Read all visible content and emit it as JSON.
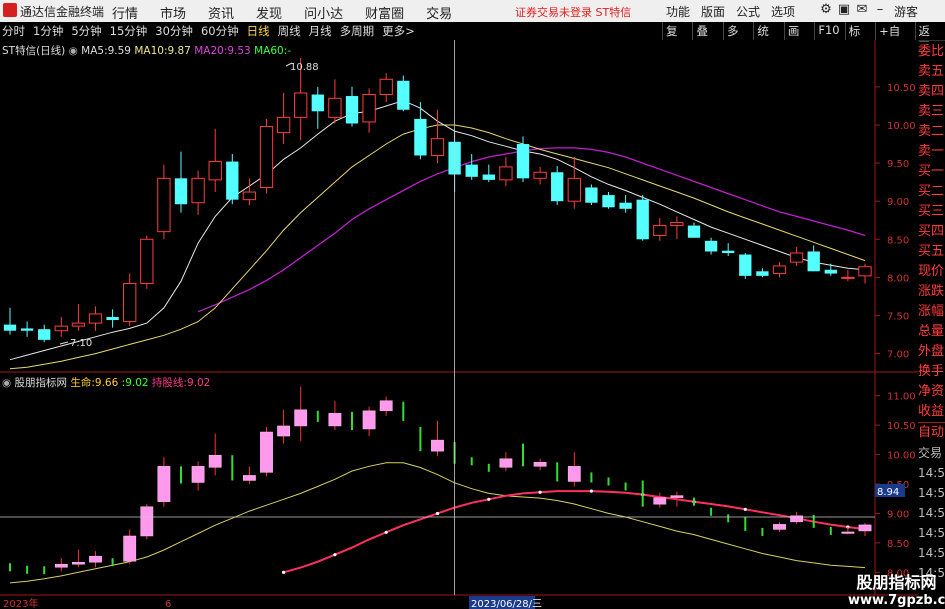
{
  "titlebar": {
    "app_name": "通达信金融终端",
    "menu": [
      "行情",
      "市场",
      "资讯",
      "发现",
      "问小达",
      "财富圈",
      "交易"
    ],
    "notice": "证券交易未登录  ST特信",
    "tools": [
      "功能",
      "版面",
      "公式",
      "选项"
    ],
    "guest": "游客"
  },
  "tabbar": {
    "tabs": [
      "分时",
      "1分钟",
      "5分钟",
      "15分钟",
      "30分钟",
      "60分钟",
      "日线",
      "周线",
      "月线",
      "多周期",
      "更多>"
    ],
    "active": "日线",
    "right_tools": [
      "复权",
      "叠加",
      "多股",
      "统计",
      "画线",
      "F10",
      "标记",
      "+自选",
      "返回"
    ]
  },
  "main_info": {
    "name": "ST特信(日线)",
    "ma5_label": "MA5:",
    "ma5": "9.59",
    "ma10_label": "MA10:",
    "ma10": "9.87",
    "ma20_label": "MA20:",
    "ma20": "9.53",
    "ma60_label": "MA60:",
    "ma60": "-"
  },
  "sub_info": {
    "name": "股朋指标网",
    "life_label": "生命:",
    "life1": "9.66",
    "life2": "9.02",
    "hold_label": "持股线:",
    "hold": "9.02"
  },
  "right_panel": {
    "labels": [
      "委比",
      "卖五",
      "卖四",
      "卖三",
      "卖二",
      "卖一",
      "买一",
      "买二",
      "买三",
      "买四",
      "买五",
      "现价",
      "涨跌",
      "涨幅",
      "总量",
      "外盘",
      "换手",
      "净资",
      "收益"
    ],
    "auto": "自动",
    "trade": "交易",
    "times": [
      "14:56",
      "14:56",
      "14:56",
      "14:56",
      "14:56",
      "14:56",
      "14:56",
      "14:56"
    ]
  },
  "bottom_axis": {
    "year": "2023年",
    "month": "6",
    "cursor_date": "2023/06/28/三"
  },
  "cursor_price": "8.94",
  "watermark": {
    "name": "股朋指标网",
    "url": "www.7gpzb.com"
  },
  "chart_data": {
    "type": "candlestick",
    "main": {
      "y_ticks": [
        "10.50",
        "10.00",
        "9.50",
        "9.00",
        "8.50",
        "8.00",
        "7.50",
        "7.00"
      ],
      "ylim": [
        6.85,
        11.05
      ],
      "high_label": "10.88",
      "low_label": "7.10",
      "candles": [
        {
          "o": 7.38,
          "h": 7.6,
          "l": 7.25,
          "c": 7.3
        },
        {
          "o": 7.33,
          "h": 7.42,
          "l": 7.22,
          "c": 7.3
        },
        {
          "o": 7.32,
          "h": 7.38,
          "l": 7.15,
          "c": 7.18
        },
        {
          "o": 7.3,
          "h": 7.48,
          "l": 7.22,
          "c": 7.36
        },
        {
          "o": 7.36,
          "h": 7.65,
          "l": 7.3,
          "c": 7.4
        },
        {
          "o": 7.4,
          "h": 7.62,
          "l": 7.3,
          "c": 7.52
        },
        {
          "o": 7.48,
          "h": 7.58,
          "l": 7.34,
          "c": 7.44
        },
        {
          "o": 7.42,
          "h": 8.05,
          "l": 7.36,
          "c": 7.92
        },
        {
          "o": 7.92,
          "h": 8.55,
          "l": 7.85,
          "c": 8.5
        },
        {
          "o": 8.6,
          "h": 9.48,
          "l": 8.5,
          "c": 9.3
        },
        {
          "o": 9.3,
          "h": 9.65,
          "l": 8.85,
          "c": 8.96
        },
        {
          "o": 8.98,
          "h": 9.4,
          "l": 8.82,
          "c": 9.3
        },
        {
          "o": 9.28,
          "h": 9.95,
          "l": 9.12,
          "c": 9.52
        },
        {
          "o": 9.52,
          "h": 9.62,
          "l": 8.96,
          "c": 9.02
        },
        {
          "o": 9.02,
          "h": 9.3,
          "l": 8.95,
          "c": 9.12
        },
        {
          "o": 9.18,
          "h": 10.08,
          "l": 9.1,
          "c": 9.98
        },
        {
          "o": 9.9,
          "h": 10.42,
          "l": 9.75,
          "c": 10.1
        },
        {
          "o": 10.1,
          "h": 10.88,
          "l": 9.8,
          "c": 10.42
        },
        {
          "o": 10.4,
          "h": 10.5,
          "l": 9.95,
          "c": 10.18
        },
        {
          "o": 10.1,
          "h": 10.6,
          "l": 10.02,
          "c": 10.35
        },
        {
          "o": 10.38,
          "h": 10.5,
          "l": 9.98,
          "c": 10.02
        },
        {
          "o": 10.04,
          "h": 10.48,
          "l": 9.9,
          "c": 10.4
        },
        {
          "o": 10.4,
          "h": 10.68,
          "l": 10.3,
          "c": 10.6
        },
        {
          "o": 10.58,
          "h": 10.65,
          "l": 10.18,
          "c": 10.2
        },
        {
          "o": 10.08,
          "h": 10.3,
          "l": 9.55,
          "c": 9.6
        },
        {
          "o": 9.6,
          "h": 10.2,
          "l": 9.5,
          "c": 9.82
        },
        {
          "o": 9.78,
          "h": 9.92,
          "l": 9.12,
          "c": 9.35
        },
        {
          "o": 9.48,
          "h": 9.62,
          "l": 9.28,
          "c": 9.32
        },
        {
          "o": 9.35,
          "h": 9.48,
          "l": 9.25,
          "c": 9.28
        },
        {
          "o": 9.28,
          "h": 9.58,
          "l": 9.2,
          "c": 9.45
        },
        {
          "o": 9.75,
          "h": 9.85,
          "l": 9.25,
          "c": 9.3
        },
        {
          "o": 9.3,
          "h": 9.45,
          "l": 9.22,
          "c": 9.38
        },
        {
          "o": 9.38,
          "h": 9.46,
          "l": 8.95,
          "c": 9.0
        },
        {
          "o": 9.0,
          "h": 9.58,
          "l": 8.9,
          "c": 9.3
        },
        {
          "o": 9.18,
          "h": 9.22,
          "l": 8.95,
          "c": 8.98
        },
        {
          "o": 9.08,
          "h": 9.12,
          "l": 8.9,
          "c": 8.92
        },
        {
          "o": 8.98,
          "h": 9.08,
          "l": 8.85,
          "c": 8.9
        },
        {
          "o": 9.02,
          "h": 9.08,
          "l": 8.48,
          "c": 8.5
        },
        {
          "o": 8.55,
          "h": 8.78,
          "l": 8.48,
          "c": 8.68
        },
        {
          "o": 8.68,
          "h": 8.8,
          "l": 8.5,
          "c": 8.72
        },
        {
          "o": 8.68,
          "h": 8.72,
          "l": 8.52,
          "c": 8.52
        },
        {
          "o": 8.48,
          "h": 8.52,
          "l": 8.3,
          "c": 8.34
        },
        {
          "o": 8.35,
          "h": 8.45,
          "l": 8.28,
          "c": 8.32
        },
        {
          "o": 8.3,
          "h": 8.32,
          "l": 7.98,
          "c": 8.02
        },
        {
          "o": 8.08,
          "h": 8.12,
          "l": 8.0,
          "c": 8.02
        },
        {
          "o": 8.05,
          "h": 8.2,
          "l": 8.0,
          "c": 8.15
        },
        {
          "o": 8.2,
          "h": 8.4,
          "l": 8.15,
          "c": 8.32
        },
        {
          "o": 8.34,
          "h": 8.42,
          "l": 8.08,
          "c": 8.08
        },
        {
          "o": 8.1,
          "h": 8.18,
          "l": 8.02,
          "c": 8.05
        },
        {
          "o": 8.0,
          "h": 8.1,
          "l": 7.95,
          "c": 8.0
        },
        {
          "o": 8.02,
          "h": 8.18,
          "l": 7.92,
          "c": 8.14
        }
      ],
      "ma5": [
        6.92,
        6.98,
        7.04,
        7.1,
        7.16,
        7.22,
        7.28,
        7.33,
        7.4,
        7.6,
        7.95,
        8.45,
        8.8,
        9.05,
        9.2,
        9.35,
        9.55,
        9.7,
        9.88,
        10.05,
        10.15,
        10.18,
        10.25,
        10.32,
        10.22,
        10.05,
        9.92,
        9.86,
        9.78,
        9.72,
        9.66,
        9.62,
        9.55,
        9.44,
        9.32,
        9.22,
        9.14,
        9.05,
        8.96,
        8.86,
        8.76,
        8.66,
        8.58,
        8.5,
        8.42,
        8.34,
        8.26,
        8.2,
        8.16,
        8.12,
        8.1
      ],
      "ma10": [
        6.8,
        6.82,
        6.86,
        6.9,
        6.95,
        7.0,
        7.06,
        7.12,
        7.18,
        7.24,
        7.32,
        7.42,
        7.6,
        7.85,
        8.1,
        8.35,
        8.62,
        8.85,
        9.05,
        9.25,
        9.45,
        9.6,
        9.75,
        9.88,
        9.95,
        10.0,
        10.0,
        9.96,
        9.9,
        9.82,
        9.75,
        9.68,
        9.62,
        9.56,
        9.5,
        9.44,
        9.36,
        9.28,
        9.2,
        9.12,
        9.04,
        8.95,
        8.86,
        8.78,
        8.7,
        8.62,
        8.54,
        8.46,
        8.38,
        8.3,
        8.22
      ],
      "ma20": [
        null,
        null,
        null,
        null,
        null,
        null,
        null,
        null,
        null,
        null,
        null,
        7.55,
        7.64,
        7.74,
        7.84,
        7.96,
        8.1,
        8.26,
        8.42,
        8.58,
        8.76,
        8.9,
        9.02,
        9.14,
        9.26,
        9.36,
        9.44,
        9.52,
        9.58,
        9.62,
        9.66,
        9.69,
        9.7,
        9.7,
        9.68,
        9.64,
        9.58,
        9.5,
        9.42,
        9.34,
        9.26,
        9.18,
        9.1,
        9.02,
        8.94,
        8.86,
        8.8,
        8.74,
        8.68,
        8.62,
        8.55
      ],
      "cursor_index": 26
    },
    "sub": {
      "y_ticks": [
        "11.00",
        "10.50",
        "10.00",
        "9.50",
        "9.00",
        "8.50",
        "8.00"
      ],
      "ylim": [
        7.7,
        11.3
      ],
      "cursor_value": 8.94,
      "life": [
        7.82,
        7.85,
        7.89,
        7.94,
        8.0,
        8.06,
        8.12,
        8.18,
        8.26,
        8.38,
        8.52,
        8.66,
        8.8,
        8.92,
        9.04,
        9.14,
        9.24,
        9.34,
        9.46,
        9.58,
        9.72,
        9.8,
        9.86,
        9.86,
        9.78,
        9.66,
        9.52,
        9.42,
        9.34,
        9.3,
        9.28,
        9.26,
        9.22,
        9.16,
        9.08,
        9.0,
        8.94,
        8.86,
        8.78,
        8.7,
        8.64,
        8.56,
        8.48,
        8.4,
        8.32,
        8.26,
        8.2,
        8.16,
        8.12,
        8.1,
        8.08
      ],
      "hold": [
        null,
        null,
        null,
        null,
        null,
        null,
        null,
        null,
        null,
        null,
        null,
        null,
        null,
        null,
        null,
        null,
        8.0,
        8.08,
        8.18,
        8.3,
        8.42,
        8.56,
        8.68,
        8.8,
        8.9,
        9.0,
        9.1,
        9.18,
        9.24,
        9.3,
        9.34,
        9.36,
        9.38,
        9.38,
        9.38,
        9.37,
        9.35,
        9.32,
        9.28,
        9.24,
        9.2,
        9.16,
        9.12,
        9.07,
        9.02,
        8.97,
        8.92,
        8.86,
        8.81,
        8.77,
        8.73
      ]
    }
  }
}
